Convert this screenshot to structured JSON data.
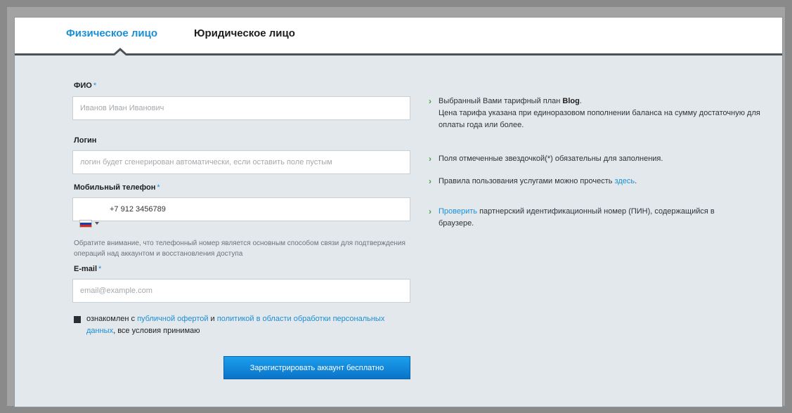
{
  "tabs": {
    "individual": "Физическое лицо",
    "legal": "Юридическое лицо"
  },
  "form": {
    "fio": {
      "label": "ФИО",
      "required": "*",
      "placeholder": "Иванов Иван Иванович"
    },
    "login": {
      "label": "Логин",
      "placeholder": "логин будет сгенерирован автоматически, если оставить поле пустым"
    },
    "phone": {
      "label": "Мобильный телефон",
      "required": "*",
      "value": "+7 912 3456789",
      "country_flag": "ru-flag-icon",
      "hint": "Обратите внимание, что телефонный номер является основным способом связи для подтверждения операций над аккаунтом и восстановления доступа"
    },
    "email": {
      "label": "E-mail",
      "required": "*",
      "placeholder": "email@example.com"
    },
    "agreement": {
      "text_before": "ознакомлен с ",
      "offer_link": "публичной офертой",
      "text_and": " и ",
      "policy_link": "политикой в области обработки персональных данных",
      "text_after": ", все условия принимаю"
    },
    "submit_label": "Зарегистрировать аккаунт бесплатно"
  },
  "info": {
    "tariff_prefix": "Выбранный Вами тарифный план ",
    "tariff_name": "Blog",
    "tariff_suffix": ".",
    "tariff_note": "Цена тарифа указана при единоразовом пополнении баланса на сумму достаточную для оплаты года или более.",
    "required_note": "Поля отмеченные звездочкой(*) обязательны для заполнения.",
    "rules_prefix": "Правила пользования услугами можно прочесть ",
    "rules_link": "здесь",
    "rules_suffix": ".",
    "check_link": "Проверить",
    "check_text": " партнерский идентификационный номер (ПИН), содержащийся в браузере."
  },
  "colors": {
    "accent": "#1b8fd3",
    "bullet": "#43a83b",
    "button": "#1289dc"
  }
}
